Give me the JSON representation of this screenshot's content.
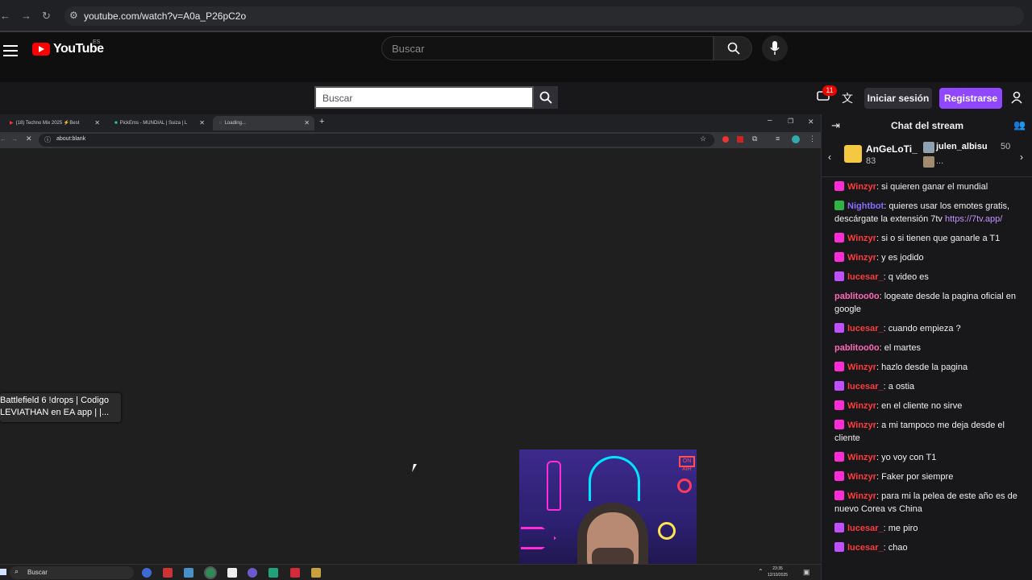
{
  "outer_browser": {
    "url": "youtube.com/watch?v=A0a_P26pC2o"
  },
  "youtube": {
    "logo_text": "YouTube",
    "country": "ES",
    "search_placeholder": "Buscar"
  },
  "stream_header": {
    "search_placeholder": "Buscar",
    "notif_count": "11",
    "login_label": "Iniciar sesión",
    "register_label": "Registrarse",
    "accent": "#9147ff"
  },
  "inner_browser": {
    "tabs": [
      {
        "label": "(18) Techno Mix 2025 ⚡Best"
      },
      {
        "label": "PickEms - MUNDIAL | Suiza | L"
      },
      {
        "label": "Loading..."
      }
    ],
    "url": "about:blank",
    "tooltip_line1": "Battlefield 6 !drops | Codigo",
    "tooltip_line2": "LEVIATHAN en EA app | |..."
  },
  "taskbar": {
    "search": "Buscar",
    "time": "23:35",
    "date": "12/10/2025"
  },
  "webcam": {
    "sign": "ON AIR"
  },
  "chat": {
    "title": "Chat del stream",
    "gifts": [
      {
        "name": "AnGeLoTi_",
        "count": "83"
      },
      {
        "name": "julen_albisu",
        "count": "50",
        "more": "..."
      }
    ],
    "messages": [
      {
        "user": "Winzyr",
        "color": "#ff3b3b",
        "badge": "#ff2bd6",
        "text": ": si quieren ganar el mundial"
      },
      {
        "user": "Nightbot",
        "color": "#8a6bff",
        "badge": "#2fb344",
        "text": ": quieres usar los emotes gratis, descárgate la extensión 7tv",
        "link": "https://7tv.app/"
      },
      {
        "user": "Winzyr",
        "color": "#ff3b3b",
        "badge": "#ff2bd6",
        "text": ": si o si tienen que ganarle a T1"
      },
      {
        "user": "Winzyr",
        "color": "#ff3b3b",
        "badge": "#ff2bd6",
        "text": ": y es jodido"
      },
      {
        "user": "lucesar_",
        "color": "#ff3b3b",
        "badge": "#c04fff",
        "text": ": q video es"
      },
      {
        "user": "pablitoo0o",
        "color": "#ff69b4",
        "badge": "",
        "text": ": logeate desde la pagina oficial en google"
      },
      {
        "user": "lucesar_",
        "color": "#ff3b3b",
        "badge": "#c04fff",
        "text": ": cuando empieza ?"
      },
      {
        "user": "pablitoo0o",
        "color": "#ff69b4",
        "badge": "",
        "text": ": el martes"
      },
      {
        "user": "Winzyr",
        "color": "#ff3b3b",
        "badge": "#ff2bd6",
        "text": ": hazlo desde la pagina"
      },
      {
        "user": "lucesar_",
        "color": "#ff3b3b",
        "badge": "#c04fff",
        "text": ": a ostia"
      },
      {
        "user": "Winzyr",
        "color": "#ff3b3b",
        "badge": "#ff2bd6",
        "text": ": en el cliente no sirve"
      },
      {
        "user": "Winzyr",
        "color": "#ff3b3b",
        "badge": "#ff2bd6",
        "text": ": a mi tampoco me deja desde el cliente"
      },
      {
        "user": "Winzyr",
        "color": "#ff3b3b",
        "badge": "#ff2bd6",
        "text": ": yo voy con T1"
      },
      {
        "user": "Winzyr",
        "color": "#ff3b3b",
        "badge": "#ff2bd6",
        "text": ": Faker por siempre"
      },
      {
        "user": "Winzyr",
        "color": "#ff3b3b",
        "badge": "#ff2bd6",
        "text": ": para mi la pelea de este año es de nuevo Corea vs China"
      },
      {
        "user": "lucesar_",
        "color": "#ff3b3b",
        "badge": "#c04fff",
        "text": ": me piro"
      },
      {
        "user": "lucesar_",
        "color": "#ff3b3b",
        "badge": "#c04fff",
        "text": ": chao"
      }
    ]
  }
}
